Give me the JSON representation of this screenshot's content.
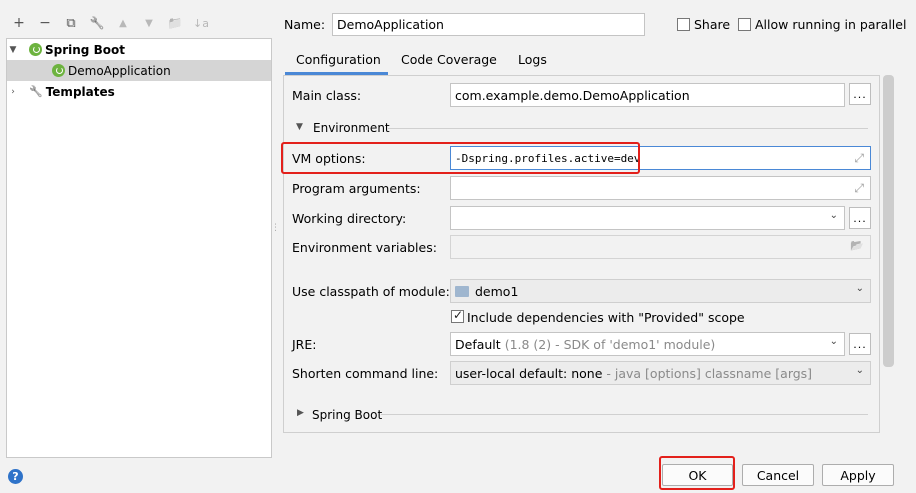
{
  "toolbar": {
    "add": "+",
    "remove": "−",
    "copy": "⧉",
    "edit": "🔧",
    "up": "▲",
    "down": "▼",
    "folder": "📁",
    "sort": "↓a"
  },
  "tree": {
    "group_label": "Spring Boot",
    "child_label": "DemoApplication",
    "templates_label": "Templates"
  },
  "header": {
    "name_label": "Name:",
    "name_value": "DemoApplication",
    "share_label": "Share",
    "parallel_label": "Allow running in parallel"
  },
  "tabs": [
    {
      "label": "Configuration"
    },
    {
      "label": "Code Coverage"
    },
    {
      "label": "Logs"
    }
  ],
  "form": {
    "main_class_label": "Main class:",
    "main_class_value": "com.example.demo.DemoApplication",
    "environment_label": "Environment",
    "vm_options_label": "VM options:",
    "vm_options_value": "-Dspring.profiles.active=dev",
    "program_args_label": "Program arguments:",
    "working_dir_label": "Working directory:",
    "env_vars_label": "Environment variables:",
    "classpath_label": "Use classpath of module:",
    "classpath_value": "demo1",
    "include_deps_label": "Include dependencies with \"Provided\" scope",
    "jre_label": "JRE:",
    "jre_value": "Default",
    "jre_detail": "(1.8 (2) - SDK of 'demo1' module)",
    "shorten_label": "Shorten command line:",
    "shorten_value": "user-local default: none",
    "shorten_detail": " - java [options] classname [args]",
    "spring_boot_section": "Spring Boot"
  },
  "buttons": {
    "ok": "OK",
    "cancel": "Cancel",
    "apply": "Apply",
    "help": "?"
  },
  "colors": {
    "highlight": "#e3201b",
    "spring_green": "#6db33f",
    "help_blue": "#2f73c9"
  }
}
